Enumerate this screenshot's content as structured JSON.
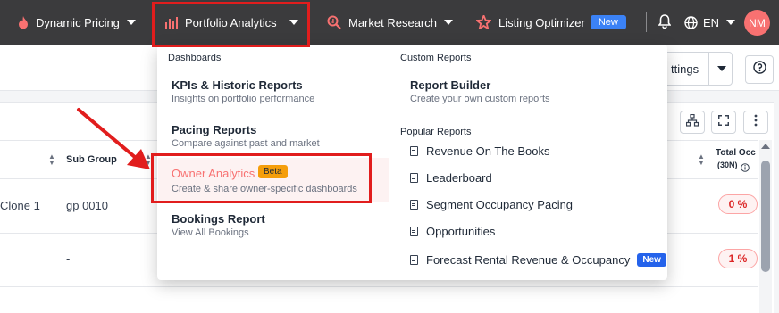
{
  "nav": {
    "items": [
      {
        "label": "Dynamic Pricing"
      },
      {
        "label": "Portfolio Analytics"
      },
      {
        "label": "Market Research"
      },
      {
        "label": "Listing Optimizer",
        "badge": "New"
      }
    ],
    "language": "EN",
    "avatar_initials": "NM"
  },
  "page": {
    "settings_label": "ttings",
    "table": {
      "headers": {
        "sub_group": "Sub Group",
        "total_occ_line1": "Total Occ",
        "total_occ_line2": "(30N)"
      },
      "rows": [
        {
          "name": "Clone 1",
          "sub_group": "gp 0010",
          "total_occ": "0 %"
        },
        {
          "name": "",
          "sub_group": "-",
          "total_occ": "1 %"
        }
      ]
    }
  },
  "dropdown": {
    "dashboards_heading": "Dashboards",
    "dashboards": [
      {
        "title": "KPIs & Historic Reports",
        "desc": "Insights on portfolio performance"
      },
      {
        "title": "Pacing Reports",
        "desc": "Compare against past and market"
      },
      {
        "title": "Owner Analytics",
        "desc": "Create & share owner-specific dashboards",
        "badge": "Beta"
      },
      {
        "title": "Bookings Report",
        "desc": "View All Bookings"
      }
    ],
    "custom_heading": "Custom Reports",
    "report_builder": {
      "title": "Report Builder",
      "desc": "Create your own custom reports"
    },
    "popular_heading": "Popular Reports",
    "popular": [
      {
        "label": "Revenue On The Books"
      },
      {
        "label": "Leaderboard"
      },
      {
        "label": "Segment Occupancy Pacing"
      },
      {
        "label": "Opportunities"
      },
      {
        "label": "Forecast Rental Revenue & Occupancy",
        "badge": "New"
      }
    ]
  },
  "colors": {
    "nav_bg": "#3b3b3d",
    "accent": "#f87171",
    "highlight_box": "#e11d1d",
    "beta_badge": "#f59e0b",
    "new_badge": "#2563eb"
  }
}
